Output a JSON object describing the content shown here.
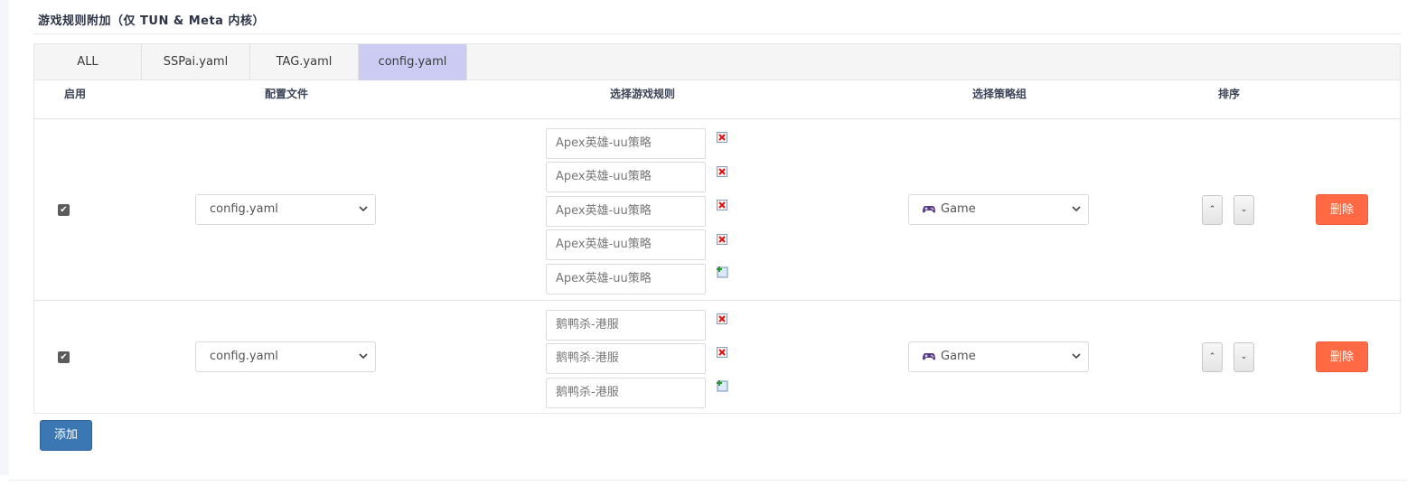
{
  "section": {
    "title": "游戏规则附加（仅 TUN & Meta 内核）"
  },
  "tabs": [
    {
      "label": "ALL"
    },
    {
      "label": "SSPai.yaml"
    },
    {
      "label": "TAG.yaml"
    },
    {
      "label": "config.yaml",
      "active": true
    }
  ],
  "table": {
    "headers": {
      "enable": "启用",
      "config_file": "配置文件",
      "game_rules": "选择游戏规则",
      "policy_group": "选择策略组",
      "sort": "排序"
    },
    "rows": [
      {
        "enabled": true,
        "config_file": "config.yaml",
        "rules": [
          {
            "placeholder": "Apex英雄-uu策略",
            "action": "remove"
          },
          {
            "placeholder": "Apex英雄-uu策略",
            "action": "remove"
          },
          {
            "placeholder": "Apex英雄-uu策略",
            "action": "remove"
          },
          {
            "placeholder": "Apex英雄-uu策略",
            "action": "remove"
          },
          {
            "placeholder": "Apex英雄-uu策略",
            "action": "add"
          }
        ],
        "policy_group": "Game",
        "delete_label": "删除"
      },
      {
        "enabled": true,
        "config_file": "config.yaml",
        "rules": [
          {
            "placeholder": "鹅鸭杀-港服",
            "action": "remove"
          },
          {
            "placeholder": "鹅鸭杀-港服",
            "action": "remove"
          },
          {
            "placeholder": "鹅鸭杀-港服",
            "action": "add"
          }
        ],
        "policy_group": "Game",
        "delete_label": "删除"
      }
    ]
  },
  "add_button": "添加",
  "colors": {
    "active_tab": "#cbcbf4",
    "delete_button": "#ff6a45",
    "add_button": "#3b77b3"
  }
}
